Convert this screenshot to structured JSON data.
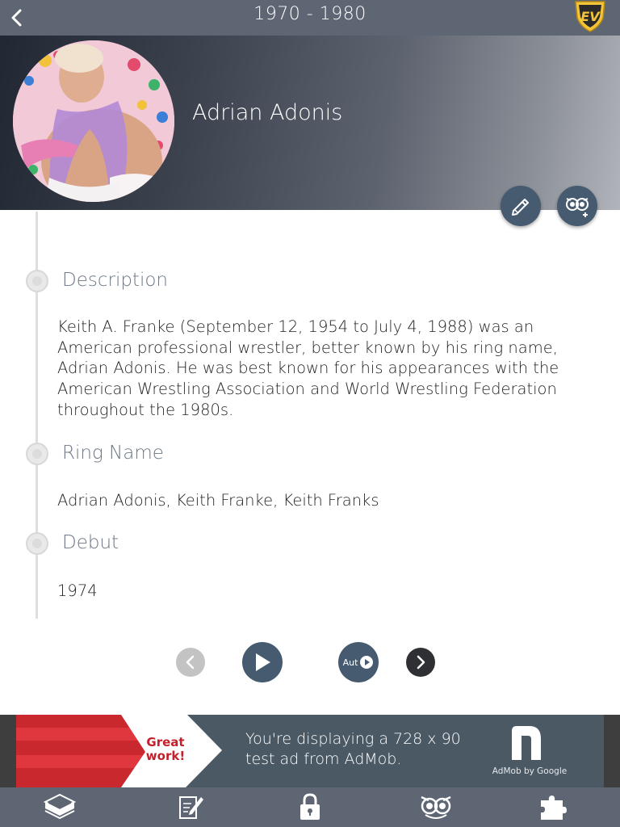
{
  "topbar": {
    "title": "1970 - 1980",
    "back_icon": "chevron-left-icon",
    "logo": {
      "text": "EV",
      "colors": {
        "shield": "#f3c33a",
        "text": "#222222"
      }
    }
  },
  "profile": {
    "name": "Adrian Adonis"
  },
  "sections": [
    {
      "title": "Description",
      "body": "Keith A. Franke (September 12, 1954 to July 4, 1988) was an American professional wrestler, better known by his ring name, Adrian Adonis. He was best known for his appearances with the American Wrestling Association and World Wrestling Federation throughout the 1980s."
    },
    {
      "title": "Ring Name",
      "body": "Adrian Adonis, Keith Franke, Keith Franks"
    },
    {
      "title": "Debut",
      "body": "1974"
    }
  ],
  "controls": {
    "auto_label": "Aut"
  },
  "ad": {
    "badge_text": "Great work!",
    "message": "You're displaying a 728 x 90 test ad from AdMob.",
    "brand": "AdMob by Google"
  },
  "tabbar": {
    "items": [
      {
        "icon": "wrestling-ring-icon"
      },
      {
        "icon": "edit-note-icon"
      },
      {
        "icon": "lock-icon"
      },
      {
        "icon": "owl-icon"
      },
      {
        "icon": "puzzle-icon"
      }
    ]
  },
  "colors": {
    "nav": "#5f6673",
    "accent": "#465a70",
    "section_title": "#6d7785"
  }
}
